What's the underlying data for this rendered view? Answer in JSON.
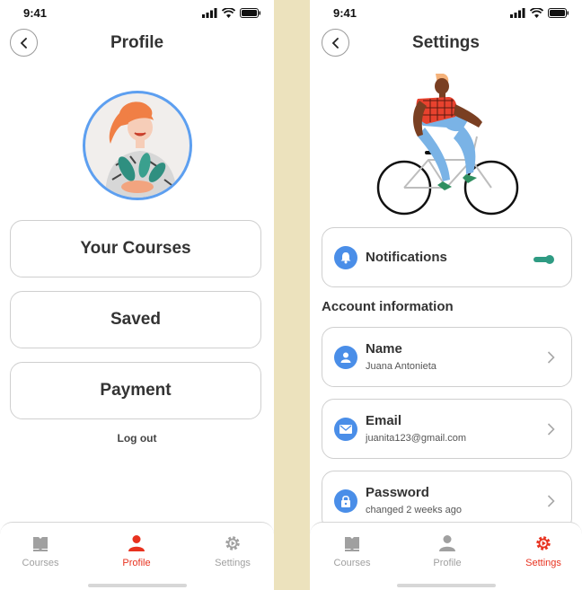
{
  "status": {
    "time": "9:41"
  },
  "profile_screen": {
    "title": "Profile",
    "menu": [
      {
        "label": "Your Courses"
      },
      {
        "label": "Saved"
      },
      {
        "label": "Payment"
      }
    ],
    "logout_label": "Log out",
    "tabs": [
      {
        "label": "Courses",
        "icon": "book-icon",
        "active": false
      },
      {
        "label": "Profile",
        "icon": "person-icon",
        "active": true
      },
      {
        "label": "Settings",
        "icon": "gear-icon",
        "active": false
      }
    ]
  },
  "settings_screen": {
    "title": "Settings",
    "notifications": {
      "label": "Notifications",
      "enabled": true
    },
    "section_title": "Account information",
    "account": [
      {
        "label": "Name",
        "value": "Juana Antonieta",
        "icon": "person-icon"
      },
      {
        "label": "Email",
        "value": "juanita123@gmail.com",
        "icon": "mail-icon"
      },
      {
        "label": "Password",
        "value": "changed 2 weeks ago",
        "icon": "lock-icon"
      }
    ],
    "tabs": [
      {
        "label": "Courses",
        "icon": "book-icon",
        "active": false
      },
      {
        "label": "Profile",
        "icon": "person-icon",
        "active": false
      },
      {
        "label": "Settings",
        "icon": "gear-icon",
        "active": true
      }
    ]
  },
  "colors": {
    "accent_blue": "#4a8ee8",
    "active_tab_red": "#e8321f",
    "toggle_teal": "#2f9b83",
    "divider_beige": "#ece2bd"
  }
}
